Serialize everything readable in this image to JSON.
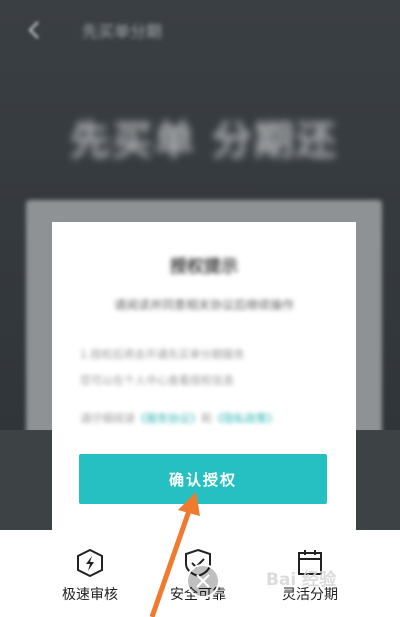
{
  "dialog": {
    "title": "授权提示",
    "subtitle": "请阅读并同意相关协议后继续操作",
    "line1": "1.授权后将会开通先买单分期服务",
    "line2": "您可以在个人中心查看授权信息",
    "line3_prefix": "请仔细阅读",
    "line3_link": "《服务协议》",
    "line3_mid": "和",
    "line3_link2": "《隐私政策》",
    "confirm_label": "确认授权"
  },
  "background": {
    "title": "先买单分期",
    "headline": "先买单 分期还"
  },
  "features": [
    {
      "label": "极速审核",
      "icon": "lightning-shield-icon"
    },
    {
      "label": "安全可靠",
      "icon": "check-shield-icon"
    },
    {
      "label": "灵活分期",
      "icon": "calendar-icon"
    }
  ],
  "watermark": "Bai 经验",
  "colors": {
    "accent": "#27c0c2",
    "arrow": "#f07a2d"
  }
}
